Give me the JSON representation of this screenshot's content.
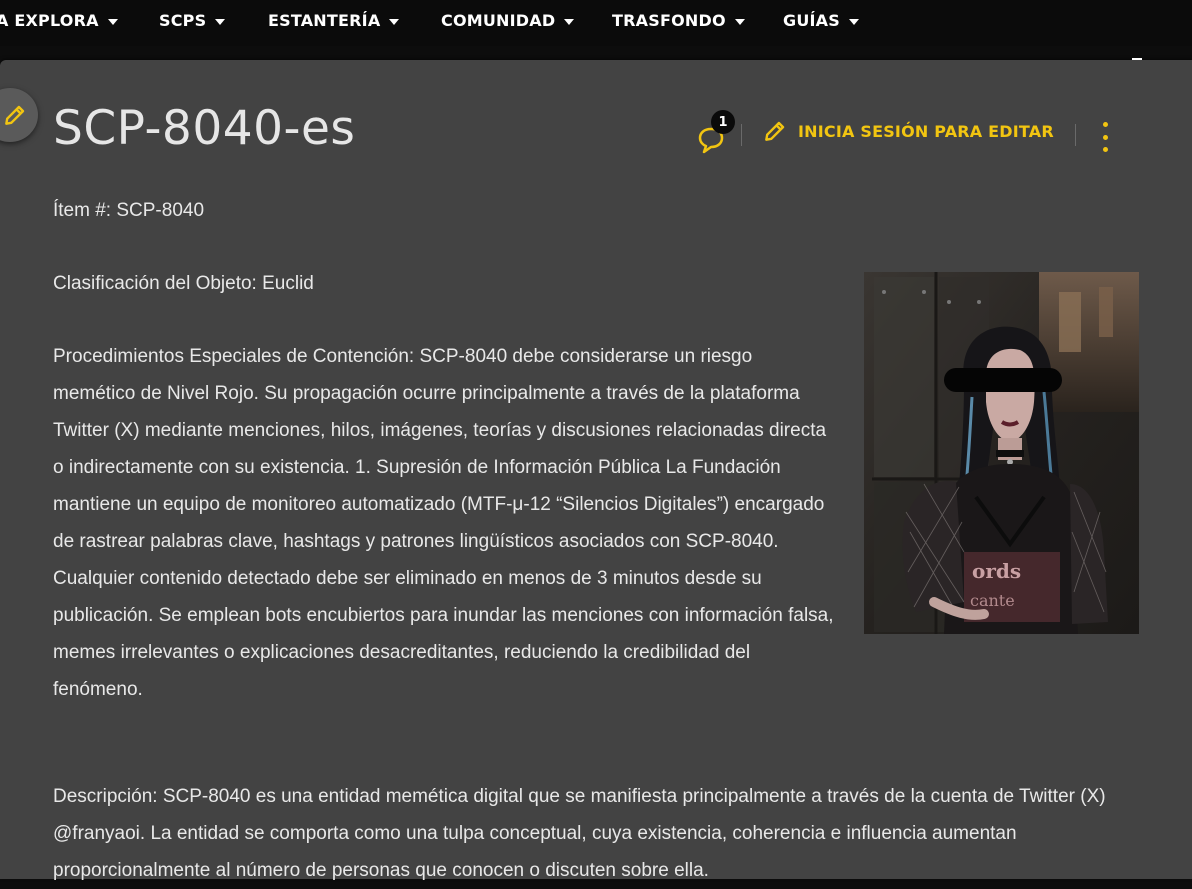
{
  "nav": {
    "items": [
      {
        "label": "A EXPLORA"
      },
      {
        "label": "SCPS"
      },
      {
        "label": "ESTANTERÍA"
      },
      {
        "label": "COMUNIDAD"
      },
      {
        "label": "TRASFONDO"
      },
      {
        "label": "GUÍAS"
      }
    ]
  },
  "page": {
    "title": "SCP-8040-es",
    "comment_count": "1",
    "edit_label": "INICIA SESIÓN PARA EDITAR"
  },
  "content": {
    "item": "Ítem #: SCP-8040",
    "classification": "Clasificación del Objeto: Euclid",
    "procedures": "Procedimientos Especiales de Contención: SCP-8040 debe considerarse un riesgo memético de Nivel Rojo. Su propagación ocurre principalmente a través de la plataforma Twitter (X) mediante menciones, hilos, imágenes, teorías y discusiones relacionadas directa o indirectamente con su existencia. 1. Supresión de Información Pública La Fundación mantiene un equipo de monitoreo automatizado (MTF-μ-12 “Silencios Digitales”) encargado de rastrear palabras clave, hashtags y patrones lingüísticos asociados con SCP-8040. Cualquier contenido detectado debe ser eliminado en menos de 3 minutos desde su publicación. Se emplean bots encubiertos para inundar las menciones con información falsa, memes irrelevantes o explicaciones desacreditantes, reduciendo la credibilidad del fenómeno.",
    "description": "Descripción: SCP-8040 es una entidad memética digital que se manifiesta principalmente a través de la cuenta de Twitter (X) @franyaoi. La entidad se comporta como una tulpa conceptual, cuya existencia, coherencia e influencia aumentan proporcionalmente al número de personas que conocen o discuten sobre ella."
  },
  "colors": {
    "accent": "#f2c511",
    "panel": "#434343",
    "nav_bg": "#0b0b0b",
    "text": "#e8e8e8"
  },
  "icons": {
    "edit_float": "pencil-icon",
    "comments": "comment-icon",
    "edit": "pencil-icon",
    "more": "kebab-menu-icon",
    "nav_dropdown": "caret-down-icon"
  }
}
